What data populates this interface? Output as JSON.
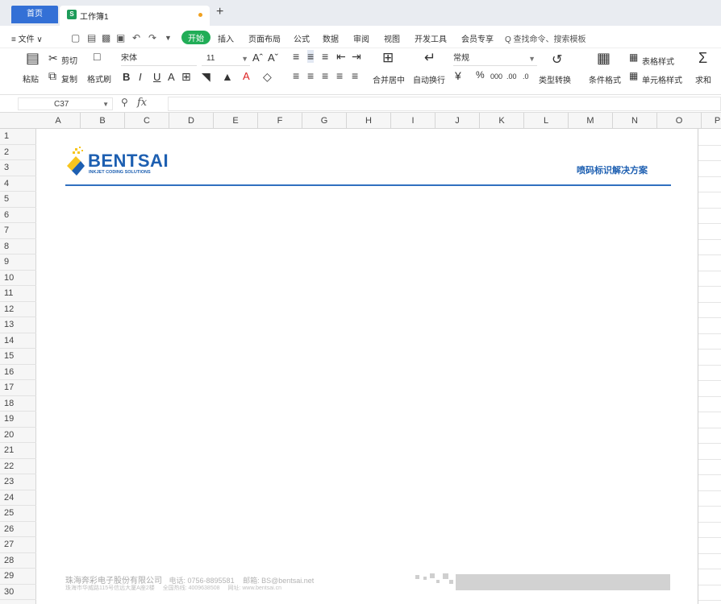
{
  "titlebar": {
    "home_tab": "首页",
    "doc_tab": "工作簿1",
    "doc_icon": "S"
  },
  "menu": {
    "file": "≡ 文件 ∨",
    "items": [
      "开始",
      "插入",
      "页面布局",
      "公式",
      "数据",
      "审阅",
      "视图",
      "开发工具",
      "会员专享"
    ],
    "search": "Q 查找命令、搜索模板"
  },
  "ribbon": {
    "paste": "粘贴",
    "cut": "剪切",
    "copy": "复制",
    "format_painter": "格式刷",
    "font_name": "宋体",
    "font_size": "11",
    "merge": "合并居中",
    "wrap": "自动换行",
    "number_format": "常规",
    "type_convert": "类型转换",
    "cond_format": "条件格式",
    "table_style": "表格样式",
    "cell_style": "单元格样式",
    "sum": "求和"
  },
  "formula_bar": {
    "cell_ref": "C37",
    "fx": "fx",
    "value": ""
  },
  "columns": [
    "A",
    "B",
    "C",
    "D",
    "E",
    "F",
    "G",
    "H",
    "I",
    "J",
    "K",
    "L",
    "M",
    "N",
    "O",
    "P"
  ],
  "rows": [
    "1",
    "2",
    "3",
    "4",
    "5",
    "6",
    "7",
    "8",
    "9",
    "10",
    "11",
    "12",
    "13",
    "14",
    "15",
    "16",
    "17",
    "18",
    "19",
    "20",
    "21",
    "22",
    "23",
    "24",
    "25",
    "26",
    "27",
    "28",
    "29",
    "30"
  ],
  "letterhead": {
    "logo_text": "BENTSAI",
    "logo_tagline": "INKJET CODING SOLUTIONS",
    "slogan": "喷码标识解决方案",
    "footer_company": "珠海奔彩电子股份有限公司",
    "footer_tel": "电话: 0756-8895581",
    "footer_email": "邮箱: BS@bentsai.net",
    "footer_address": "珠海市华威路115号信远大厦A座2楼",
    "footer_hotline": "全国热线: 4009638508",
    "footer_web": "网址: www.bentsai.cn"
  },
  "colors": {
    "accent_blue": "#1d5fb1",
    "logo_yellow": "#f7c51e",
    "start_green": "#21ad57",
    "home_tab": "#3370d6"
  }
}
